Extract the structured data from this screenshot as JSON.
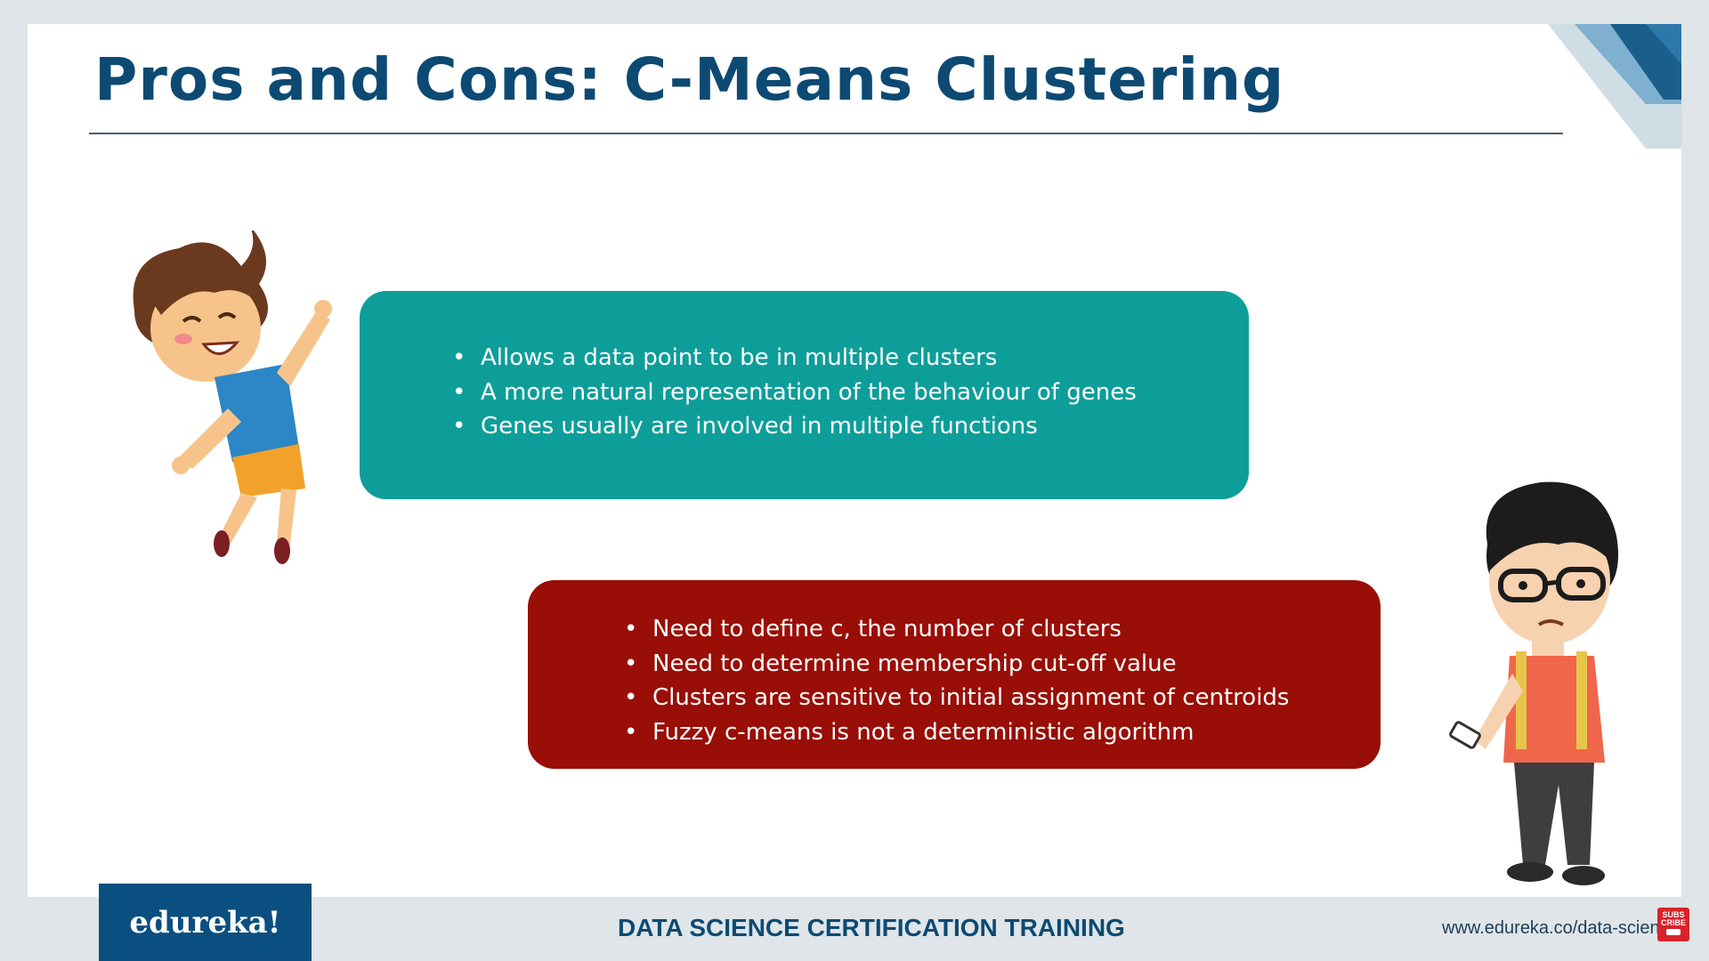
{
  "slide": {
    "title": "Pros and Cons: C-Means Clustering",
    "pros": [
      "Allows a data point to be in multiple clusters",
      "A more natural representation of the behaviour of genes",
      "Genes usually are involved in multiple functions"
    ],
    "cons": [
      "Need to define c, the number of clusters",
      "Need to determine membership cut-off value",
      "Clusters are sensitive to initial assignment of centroids",
      "Fuzzy c-means is not a deterministic algorithm"
    ]
  },
  "footer": {
    "logo": "edureka!",
    "course": "DATA SCIENCE CERTIFICATION TRAINING",
    "url": "www.edureka.co/data-scien",
    "subscribe": "SUBS CRIBE"
  },
  "colors": {
    "title": "#0c4a73",
    "pros": "#0e9e9a",
    "cons": "#990e06",
    "logo_bg": "#0b4f80"
  },
  "icons": [
    "happy-kid-illustration",
    "confused-kid-illustration",
    "corner-stripes-decoration"
  ]
}
